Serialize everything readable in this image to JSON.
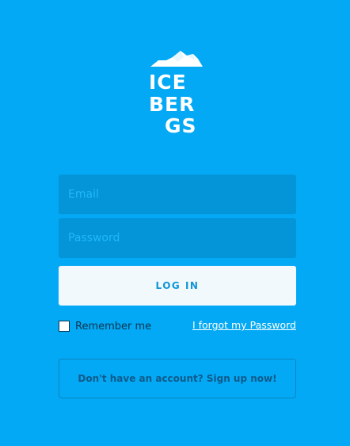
{
  "brand": {
    "logo_lines": [
      "ICE",
      "BER",
      "GS"
    ],
    "logo_icon": "iceberg-mountain-icon",
    "background_color": "#03a9f4",
    "logo_color": "#ffffff"
  },
  "form": {
    "email_placeholder": "Email",
    "password_placeholder": "Password",
    "login_label": "LOG IN",
    "remember_label": "Remember me",
    "remember_checked": false,
    "forgot_label": "I forgot my Password"
  },
  "signup": {
    "label": "Don't have an account? Sign up now!"
  }
}
